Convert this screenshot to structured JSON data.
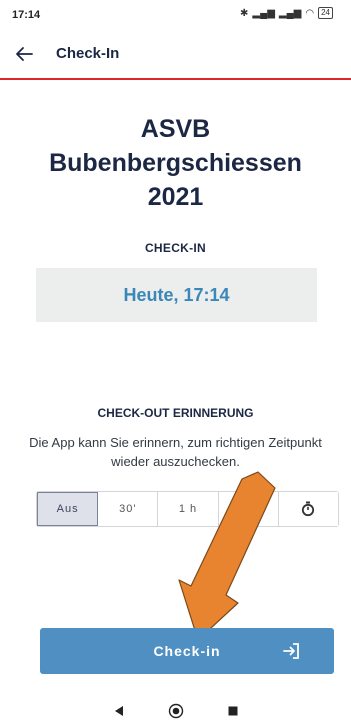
{
  "status": {
    "time": "17:14",
    "battery": "24"
  },
  "app_bar": {
    "title": "Check-In"
  },
  "event": {
    "title_line1": "ASVB",
    "title_line2": "Bubenbergschiessen",
    "title_line3": "2021"
  },
  "checkin": {
    "label": "CHECK-IN",
    "time": "Heute, 17:14"
  },
  "reminder": {
    "title": "CHECK-OUT ERINNERUNG",
    "description": "Die App kann Sie erinnern, zum richtigen Zeitpunkt wieder auszuchecken.",
    "options": [
      "Aus",
      "30'",
      "1 h",
      "",
      ""
    ],
    "selected": "Aus"
  },
  "button": {
    "label": "Check-in"
  },
  "colors": {
    "accent": "#4f8fc2",
    "divider": "#d9262b",
    "time_text": "#3a87b8",
    "arrow": "#e8832f"
  }
}
